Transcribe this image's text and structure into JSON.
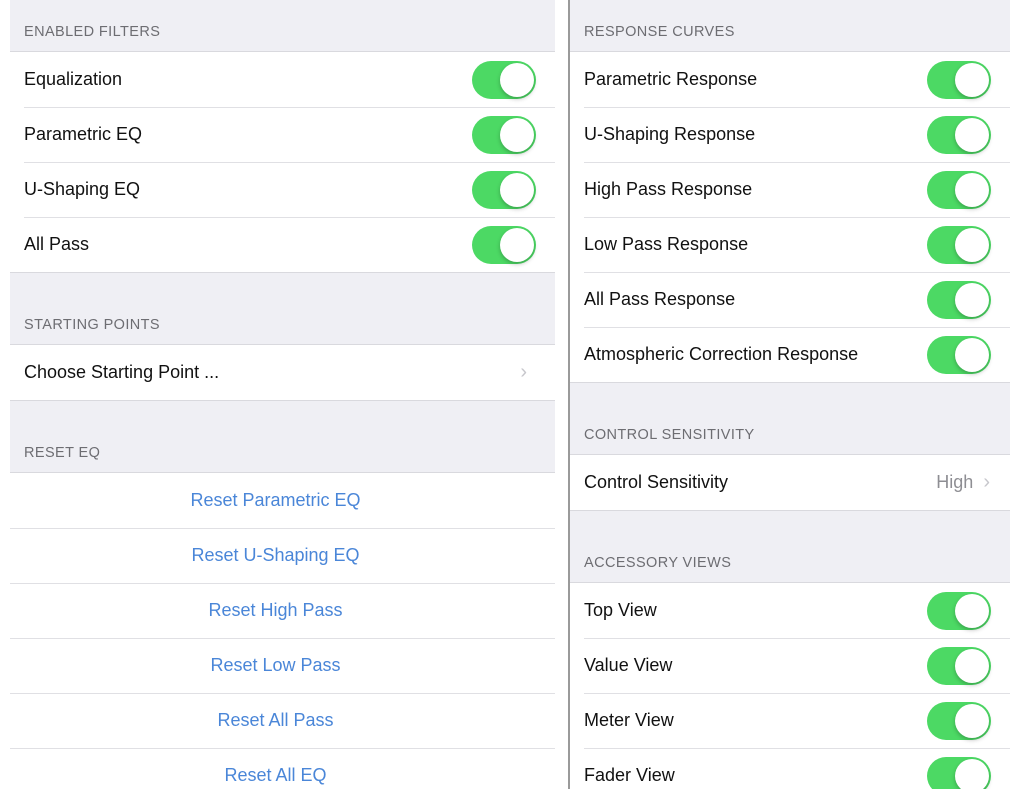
{
  "left": {
    "enabled_filters": {
      "header": "ENABLED FILTERS",
      "items": [
        {
          "label": "Equalization",
          "on": true
        },
        {
          "label": "Parametric EQ",
          "on": true
        },
        {
          "label": "U-Shaping EQ",
          "on": true
        },
        {
          "label": "All Pass",
          "on": true
        }
      ]
    },
    "starting_points": {
      "header": "STARTING POINTS",
      "choose_label": "Choose Starting Point ..."
    },
    "reset_eq": {
      "header": "RESET EQ",
      "actions": [
        "Reset Parametric EQ",
        "Reset U-Shaping EQ",
        "Reset High Pass",
        "Reset Low Pass",
        "Reset All Pass",
        "Reset All EQ"
      ]
    }
  },
  "right": {
    "response_curves": {
      "header": "RESPONSE CURVES",
      "items": [
        {
          "label": "Parametric Response",
          "on": true
        },
        {
          "label": "U-Shaping Response",
          "on": true
        },
        {
          "label": "High Pass Response",
          "on": true
        },
        {
          "label": "Low Pass Response",
          "on": true
        },
        {
          "label": "All Pass Response",
          "on": true
        },
        {
          "label": "Atmospheric Correction Response",
          "on": true
        }
      ]
    },
    "control_sensitivity": {
      "header": "CONTROL SENSITIVITY",
      "label": "Control Sensitivity",
      "value": "High"
    },
    "accessory_views": {
      "header": "ACCESSORY VIEWS",
      "items": [
        {
          "label": "Top View",
          "on": true
        },
        {
          "label": "Value View",
          "on": true
        },
        {
          "label": "Meter View",
          "on": true
        },
        {
          "label": "Fader View",
          "on": true
        }
      ]
    }
  },
  "colors": {
    "switch_on": "#4cd964",
    "action_text": "#4a86d8"
  },
  "icons": {
    "chevron": "chevron-right-icon"
  }
}
